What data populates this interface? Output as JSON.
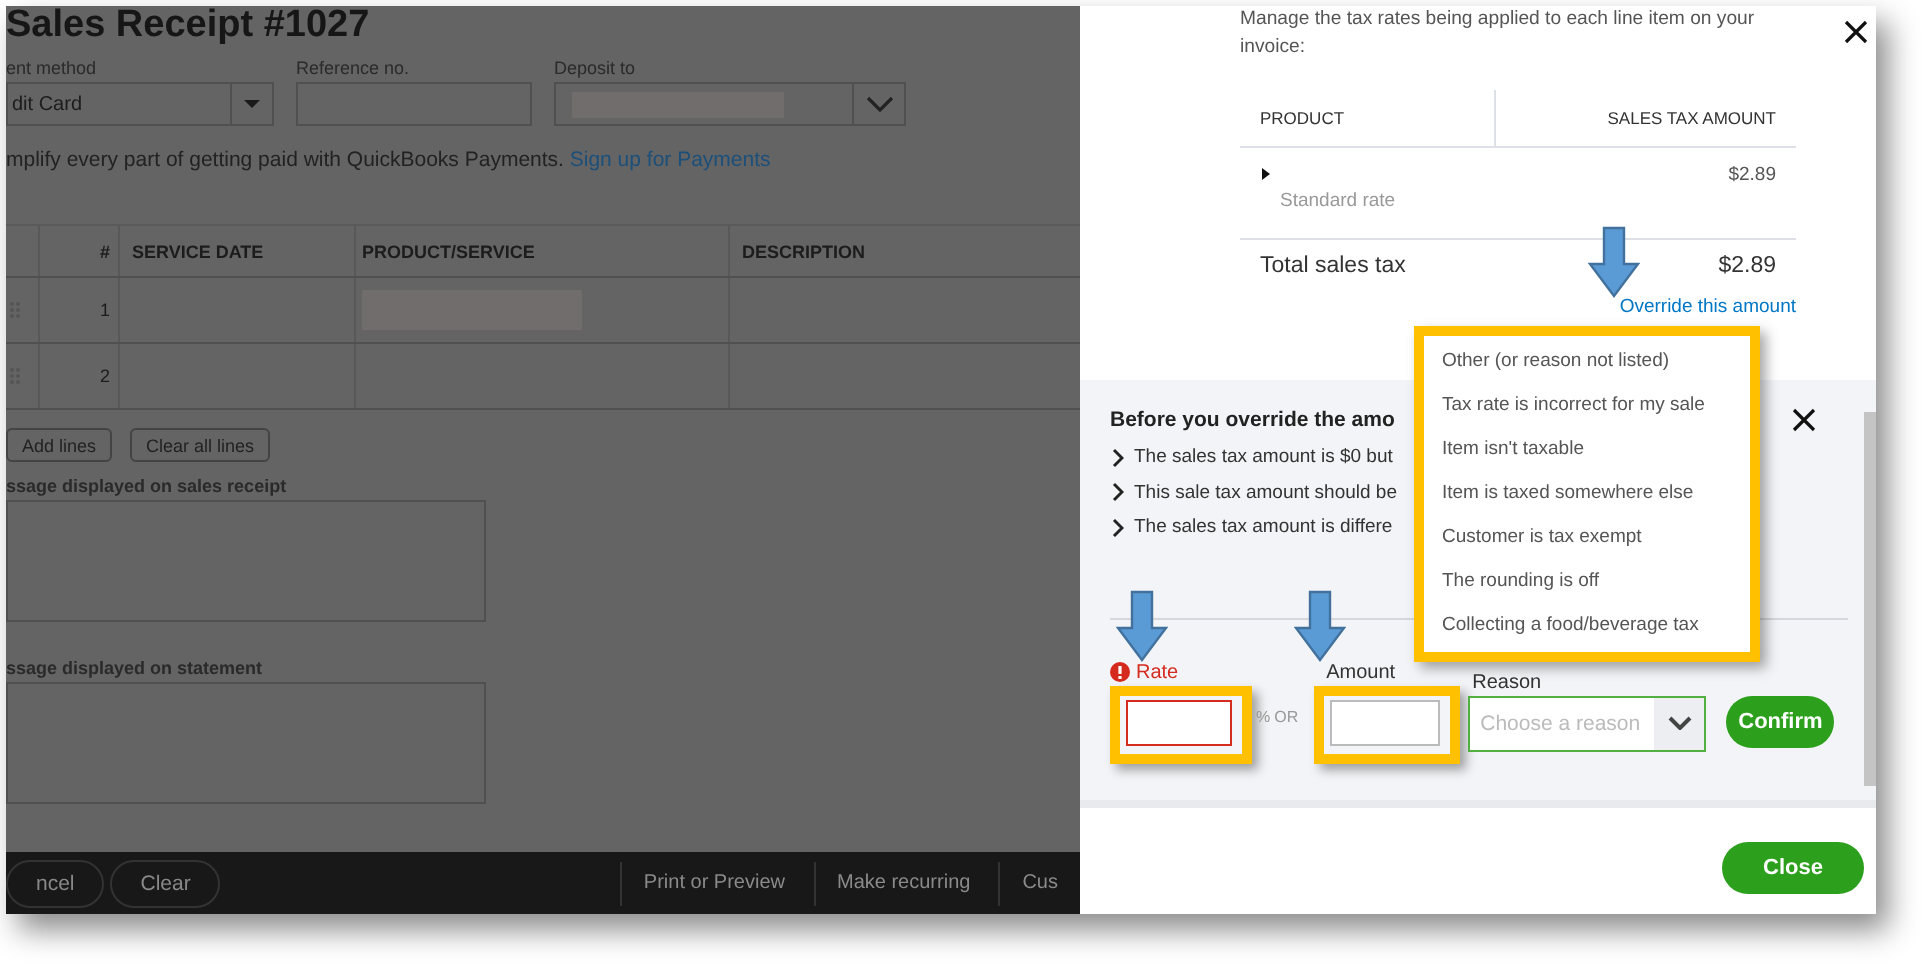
{
  "page": {
    "title": "Sales Receipt #1027",
    "fields": [
      {
        "kind": "select",
        "label": "ent method",
        "value": "dit Card"
      },
      {
        "kind": "text",
        "label": "Reference no."
      },
      {
        "kind": "combo",
        "label": "Deposit to",
        "redacted": true
      }
    ],
    "promo": {
      "text": "mplify every part of getting paid with QuickBooks Payments.",
      "link": "Sign up for Payments"
    },
    "table": {
      "columns": [
        "#",
        "SERVICE DATE",
        "PRODUCT/SERVICE",
        "DESCRIPTION"
      ],
      "rows": [
        {
          "number": "1",
          "redacted": true
        },
        {
          "number": "2",
          "redacted": false
        }
      ]
    },
    "line_buttons": [
      "Add lines",
      "Clear all lines"
    ],
    "memos": [
      {
        "label": "ssage displayed on sales receipt"
      },
      {
        "label": "ssage displayed on statement"
      }
    ],
    "footer": {
      "buttons": [
        "ncel",
        "Clear"
      ],
      "links": [
        "Print or Preview",
        "Make recurring",
        "Cus"
      ]
    }
  },
  "panel": {
    "intro": "Manage the tax rates being applied to each line item on your invoice:",
    "tax_table": {
      "columns": [
        "PRODUCT",
        "SALES TAX AMOUNT"
      ],
      "rows": [
        {
          "expanded": false,
          "rate": "Standard rate",
          "amount": "$2.89"
        }
      ],
      "total": {
        "label": "Total sales tax",
        "amount": "$2.89"
      }
    },
    "override_link": "Override this amount",
    "override": {
      "title": "Before you override the amo",
      "bullets": [
        "The sales tax amount is $0 but",
        "This sale tax amount should be",
        "The sales tax amount is differe"
      ],
      "rate": {
        "label": "Rate",
        "error": true
      },
      "percent": "%",
      "or": "OR",
      "amount": {
        "label": "Amount"
      },
      "reason": {
        "label": "Reason",
        "placeholder": "Choose a reason"
      },
      "confirm": "Confirm"
    },
    "reason_menu": [
      "Other (or reason not listed)",
      "Tax rate is incorrect for my sale",
      "Item isn't taxable",
      "Item is taxed somewhere else",
      "Customer is tax exempt",
      "The rounding is off",
      "Collecting a food/beverage tax"
    ],
    "close": "Close"
  }
}
